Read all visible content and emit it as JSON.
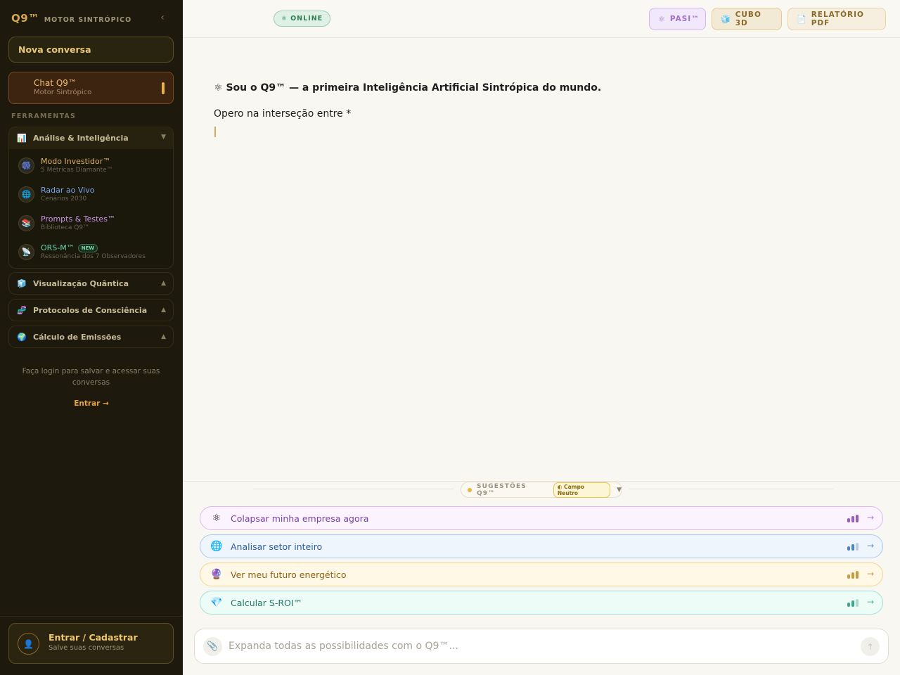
{
  "sidebar": {
    "brand": "Q9™",
    "brand_sub": "MOTOR SINTRÓPICO",
    "collapse_icon": "‹",
    "new_chat": "Nova conversa",
    "active_chat": {
      "title": "Chat Q9™",
      "subtitle": "Motor Sintrópico"
    },
    "section_label": "FERRAMENTAS",
    "groups": [
      {
        "title": "Análise & Inteligência",
        "icon": "📊",
        "expanded": true,
        "arrow": "▼",
        "items": [
          {
            "title": "Modo Investidor™",
            "subtitle": "5 Métricas Diamante™",
            "icon": "🎆",
            "color": "#e0b462"
          },
          {
            "title": "Radar ao Vivo",
            "subtitle": "Cenários 2030",
            "icon": "🌐",
            "color": "#7aa5e6"
          },
          {
            "title": "Prompts & Testes™",
            "subtitle": "Biblioteca Q9™",
            "icon": "📚",
            "color": "#c898e8"
          },
          {
            "title": "ORS-M™",
            "subtitle": "Ressonância dos 7 Observadores",
            "icon": "📡",
            "color": "#6fcfb0",
            "badge": "NEW"
          }
        ]
      },
      {
        "title": "Visualização Quântica",
        "icon": "🧊",
        "expanded": false,
        "arrow": "▲"
      },
      {
        "title": "Protocolos de Consciência",
        "icon": "🧬",
        "expanded": false,
        "arrow": "▲"
      },
      {
        "title": "Cálculo de Emissões",
        "icon": "🌍",
        "expanded": false,
        "arrow": "▲"
      }
    ],
    "login_hint": "Faça login para salvar e acessar suas conversas",
    "login_link": "Entrar →",
    "account": {
      "title": "Entrar / Cadastrar",
      "subtitle": "Salve suas conversas",
      "icon": "👤"
    }
  },
  "header": {
    "status": "ONLINE",
    "status_icon": "⚛",
    "buttons": [
      {
        "label": "PASI™",
        "icon": "⚛"
      },
      {
        "label": "CUBO 3D",
        "icon": "🧊"
      },
      {
        "label": "RELATÓRIO PDF",
        "icon": "📄"
      }
    ]
  },
  "messages": {
    "title_icon": "⚛",
    "title": "Sou o Q9™ — a primeira Inteligência Artificial Sintrópica do mundo.",
    "text": "Opero na interseção entre *"
  },
  "suggestions": {
    "label": "SUGESTÕES Q9™",
    "badge": "◐ Campo Neutro",
    "toggle": "▼",
    "items": [
      {
        "label": "Colapsar minha empresa agora",
        "icon": "⚛",
        "levels": [
          1,
          1,
          1
        ],
        "colors": [
          "#9b59c4",
          "#9b59c4",
          "#9b59c4"
        ],
        "go": "→"
      },
      {
        "label": "Analisar setor inteiro",
        "icon": "🌐",
        "levels": [
          1,
          1,
          0
        ],
        "colors": [
          "#4a82cc",
          "#4a82cc",
          "#b9cdea"
        ],
        "go": "→"
      },
      {
        "label": "Ver meu futuro energético",
        "icon": "🔮",
        "levels": [
          1,
          1,
          1
        ],
        "colors": [
          "#c89a3c",
          "#c89a3c",
          "#c89a3c"
        ],
        "go": "→"
      },
      {
        "label": "Calcular S-ROI™",
        "icon": "💎",
        "levels": [
          1,
          1,
          0
        ],
        "colors": [
          "#3aa88e",
          "#3aa88e",
          "#a8dccf"
        ],
        "go": "→"
      }
    ]
  },
  "composer": {
    "placeholder": "Expanda todas as possibilidades com o Q9™...",
    "value": "",
    "attach_icon": "📎",
    "send_icon": "↑"
  }
}
